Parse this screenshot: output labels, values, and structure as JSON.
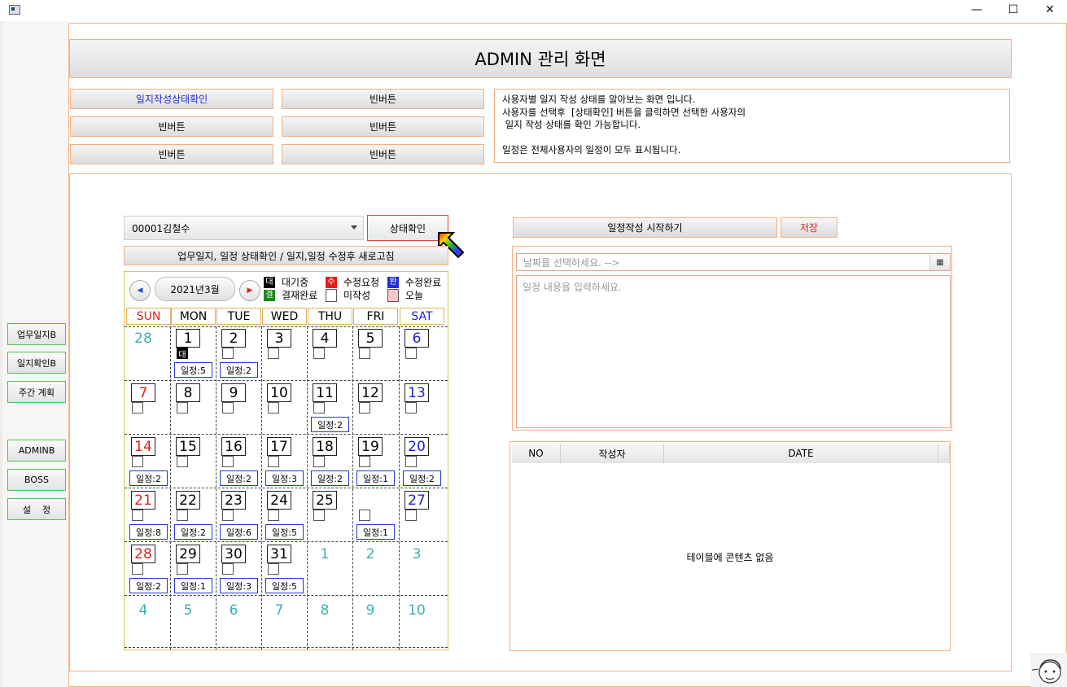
{
  "window": {
    "minimize_glyph": "—",
    "maximize_glyph": "☐",
    "close_glyph": "✕"
  },
  "sidebar": {
    "items": [
      "업무일지B",
      "일지확인B",
      "주간 계획",
      "ADMINB",
      "BOSS",
      "설    정"
    ]
  },
  "header": {
    "title": "ADMIN 관리 화면"
  },
  "top_buttons": {
    "status_check": "일지작성상태확인",
    "empty1": "빈버튼",
    "empty2": "빈버튼",
    "empty3": "빈버튼",
    "empty4": "빈버튼",
    "empty5": "빈버튼"
  },
  "description": {
    "lines": [
      "사용자별 일지 작성 상태를 알아보는 화면 입니다.",
      "사용자를 선택후  [상태확인] 버튼을 클릭하면 선택한 사용자의",
      " 일지 작성 상태를 확인 가능합니다.",
      "",
      "일정은 전체사용자의 일정이 모두 표시됩니다."
    ]
  },
  "user_combo": {
    "value": "00001김철수"
  },
  "status_button": "상태확인",
  "refresh_button": "업무일지, 일정 상태확인 / 일지,일정 수정후 새로고침",
  "calendar": {
    "month_label": "2021년3월",
    "prev_glyph": "◀",
    "next_glyph": "▶",
    "legend": {
      "waiting_icon": "대",
      "waiting": "대기중",
      "edit_request_icon": "수",
      "edit_request": "수정요청",
      "edit_done_icon": "완",
      "edit_done": "수정완료",
      "approved_icon": "결",
      "approved": "결재완료",
      "not_written": "미작성",
      "today": "오늘"
    },
    "day_headers": [
      "SUN",
      "MON",
      "TUE",
      "WED",
      "THU",
      "FRI",
      "SAT"
    ],
    "weeks": [
      [
        {
          "day": "28",
          "out": true
        },
        {
          "day": "1",
          "check": true,
          "mark": "대",
          "sched": "일정:5"
        },
        {
          "day": "2",
          "check": true,
          "sched": "일정:2"
        },
        {
          "day": "3",
          "check": true
        },
        {
          "day": "4",
          "check": true
        },
        {
          "day": "5",
          "check": true
        },
        {
          "day": "6",
          "check": true
        }
      ],
      [
        {
          "day": "7",
          "check": true
        },
        {
          "day": "8",
          "check": true
        },
        {
          "day": "9",
          "check": true
        },
        {
          "day": "10",
          "check": true
        },
        {
          "day": "11",
          "check": true,
          "sched": "일정:2"
        },
        {
          "day": "12",
          "check": true
        },
        {
          "day": "13",
          "check": true
        }
      ],
      [
        {
          "day": "14",
          "check": true,
          "sched": "일정:2"
        },
        {
          "day": "15",
          "check": true
        },
        {
          "day": "16",
          "check": true,
          "sched": "일정:2"
        },
        {
          "day": "17",
          "check": true,
          "sched": "일정:3"
        },
        {
          "day": "18",
          "check": true,
          "sched": "일정:2"
        },
        {
          "day": "19",
          "check": true,
          "sched": "일정:1"
        },
        {
          "day": "20",
          "check": true,
          "sched": "일정:2"
        }
      ],
      [
        {
          "day": "21",
          "check": true,
          "sched": "일정:8"
        },
        {
          "day": "22",
          "check": true,
          "sched": "일정:2"
        },
        {
          "day": "23",
          "check": true,
          "sched": "일정:6"
        },
        {
          "day": "24",
          "check": true,
          "sched": "일정:5"
        },
        {
          "day": "25",
          "check": true
        },
        {
          "day": "",
          "check": true,
          "sched": "일정:1",
          "nobox": true
        },
        {
          "day": "27",
          "check": true
        }
      ],
      [
        {
          "day": "28",
          "check": true,
          "sched": "일정:2"
        },
        {
          "day": "29",
          "check": true,
          "sched": "일정:1"
        },
        {
          "day": "30",
          "check": true,
          "sched": "일정:3"
        },
        {
          "day": "31",
          "check": true,
          "sched": "일정:5"
        },
        {
          "day": "1",
          "out": true
        },
        {
          "day": "2",
          "out": true
        },
        {
          "day": "3",
          "out": true
        }
      ],
      [
        {
          "day": "4",
          "out": true
        },
        {
          "day": "5",
          "out": true
        },
        {
          "day": "6",
          "out": true
        },
        {
          "day": "7",
          "out": true
        },
        {
          "day": "8",
          "out": true
        },
        {
          "day": "9",
          "out": true
        },
        {
          "day": "10",
          "out": true
        }
      ]
    ]
  },
  "schedule_editor": {
    "start_button": "일정작성 시작하기",
    "save_button": "저장",
    "date_placeholder": "날짜를 선택하세요. -->",
    "date_picker_glyph": "▦",
    "content_placeholder": "일정 내용을 입력하세요."
  },
  "table": {
    "columns": [
      "NO",
      "작성자",
      "DATE"
    ],
    "empty_text": "테이블에 콘텐츠 없음"
  },
  "colors": {
    "accent_border": "#f2b183",
    "sidebar_border": "#4ec24e",
    "sunday": "#e0201f",
    "saturday": "#2020c8",
    "out_of_month": "#3ab0b0",
    "status_btn_border": "#e0403f",
    "save_text": "#e0201f",
    "status_check_text": "#1f2fd0"
  }
}
